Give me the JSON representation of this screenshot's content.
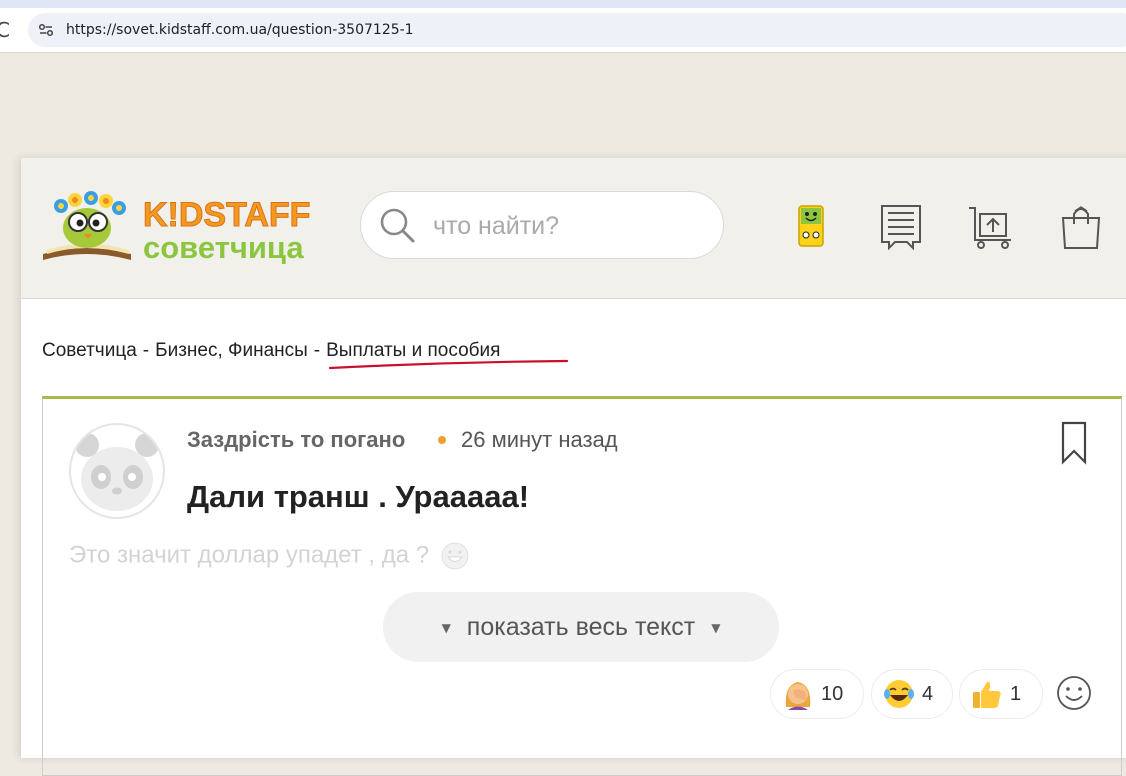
{
  "browser": {
    "url": "https://sovet.kidstaff.com.ua/question-3507125-1",
    "reload_glyph": "C"
  },
  "header": {
    "logo_top": "K!DSTAFF",
    "logo_bottom": "советчица",
    "search_placeholder": "что найти?",
    "icons": [
      "mascot-icon",
      "catalog-icon",
      "upload-cart-icon",
      "shopping-bag-icon"
    ]
  },
  "breadcrumb": {
    "items": [
      "Советчица",
      "Бизнес, Финансы",
      "Выплаты и пособия"
    ],
    "separator": "-"
  },
  "post": {
    "author": "Заздрість то погано",
    "time": "26 минут назад",
    "title": "Дали транш . Урааааа!",
    "excerpt": "Это значит доллар упадет , да ?",
    "show_more": "показать весь текст",
    "reactions": [
      {
        "icon": "facepalm-icon",
        "count": "10"
      },
      {
        "icon": "laughing-tears-icon",
        "count": "4"
      },
      {
        "icon": "thumbs-up-icon",
        "count": "1"
      }
    ]
  },
  "colors": {
    "accent_green": "#a6b94a",
    "logo_orange": "#f39a1e",
    "logo_green": "#8cc63f",
    "underline_red": "#c8102e"
  }
}
